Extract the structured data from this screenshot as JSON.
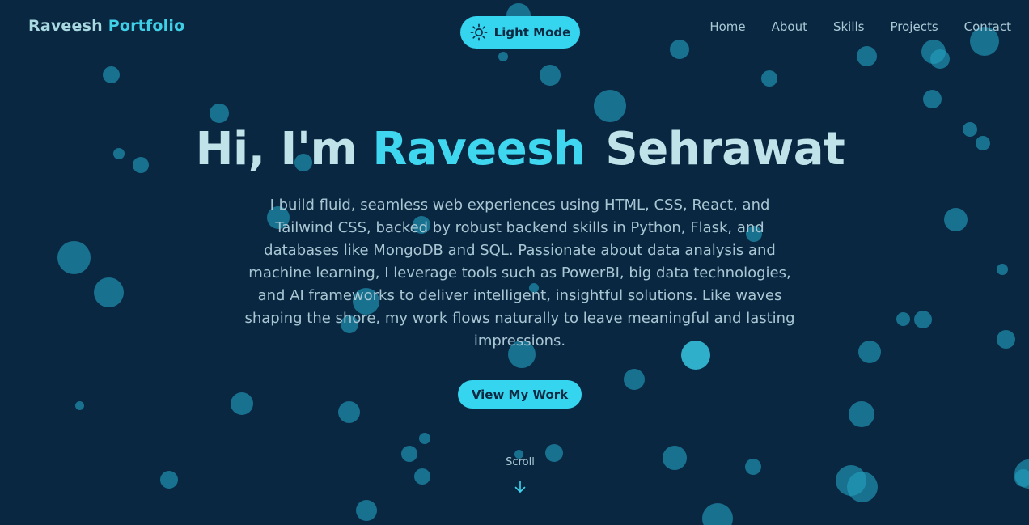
{
  "header": {
    "brand_first": "Raveesh",
    "brand_second": "Portfolio",
    "theme_toggle_label": "Light Mode",
    "theme_toggle_icon": "sun-icon",
    "nav": [
      "Home",
      "About",
      "Skills",
      "Projects",
      "Contact"
    ]
  },
  "hero": {
    "greeting": "Hi, I'm",
    "name": "Raveesh",
    "surname": "Sehrawat",
    "description": "I build fluid, seamless web experiences using HTML, CSS, React, and Tailwind CSS, backed by robust backend skills in Python, Flask, and databases like MongoDB and SQL. Passionate about data analysis and machine learning, I leverage tools such as PowerBI, big data technologies, and AI frameworks to deliver intelligent, insightful solutions. Like waves shaping the shore, my work flows naturally to leave meaningful and lasting impressions.",
    "cta_label": "View My Work",
    "scroll_label": "Scroll",
    "scroll_icon": "arrow-down-icon"
  },
  "colors": {
    "background": "#0a2742",
    "accent": "#35d5ef",
    "text": "#a9c7d3",
    "bubble": "#22a0be"
  }
}
